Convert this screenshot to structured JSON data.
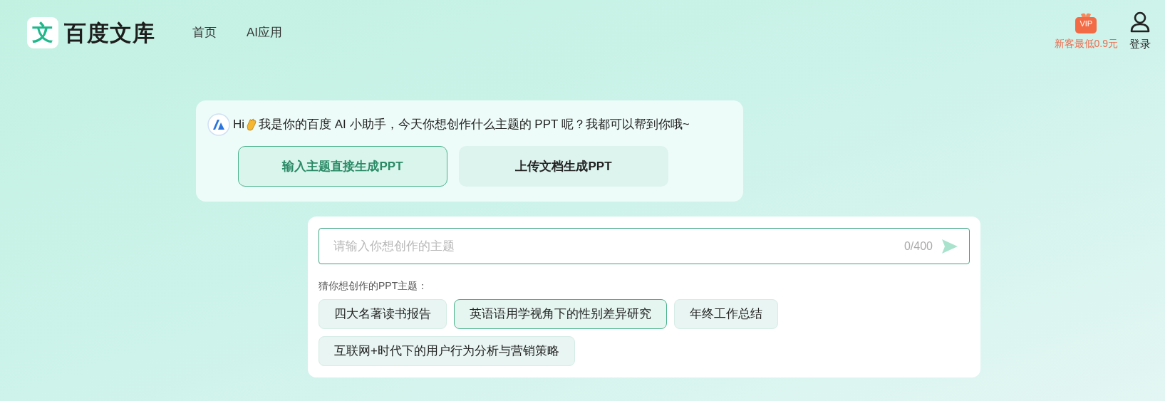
{
  "header": {
    "logo_glyph": "文",
    "logo_text": "百度文库",
    "nav": [
      {
        "label": "首页"
      },
      {
        "label": "AI应用"
      }
    ],
    "promo": {
      "badge": "VIP",
      "text": "新客最低0.9元"
    },
    "login": "登录"
  },
  "assistant": {
    "greeting_start": "Hi",
    "greeting_rest": "我是你的百度 AI 小助手，今天你想创作什么主题的 PPT 呢？我都可以帮到你哦~",
    "modes": [
      {
        "label": "输入主题直接生成PPT",
        "selected": true
      },
      {
        "label": "上传文档生成PPT",
        "selected": false
      }
    ]
  },
  "composer": {
    "placeholder": "请输入你想创作的主题",
    "counter": "0/400",
    "suggest_label": "猜你想创作的PPT主题：",
    "topics": [
      {
        "label": "四大名著读书报告",
        "selected": false
      },
      {
        "label": "英语语用学视角下的性别差异研究",
        "selected": true
      },
      {
        "label": "年终工作总结",
        "selected": false
      },
      {
        "label": "互联网+时代下的用户行为分析与营销策略",
        "selected": false
      }
    ]
  }
}
